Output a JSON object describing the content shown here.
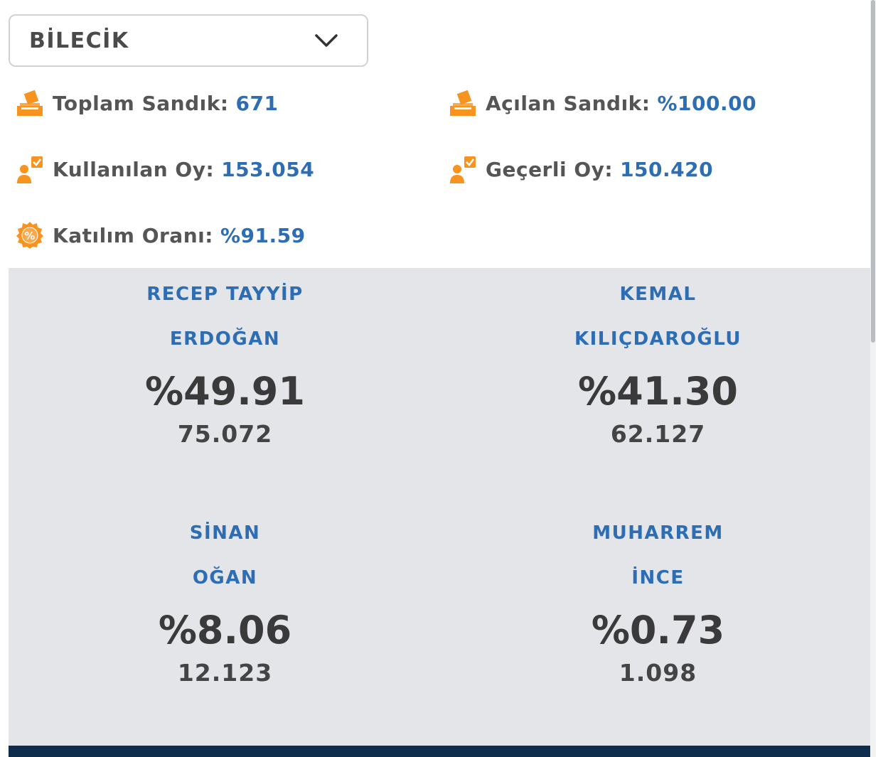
{
  "dropdown": {
    "selected": "BİLECİK"
  },
  "stats": {
    "toplam_sandik": {
      "label": "Toplam Sandık:",
      "value": "671"
    },
    "acilan_sandik": {
      "label": "Açılan Sandık:",
      "value": "%100.00"
    },
    "kullanilan_oy": {
      "label": "Kullanılan Oy:",
      "value": "153.054"
    },
    "gecerli_oy": {
      "label": "Geçerli Oy:",
      "value": "150.420"
    },
    "katilim_orani": {
      "label": "Katılım Oranı:",
      "value": "%91.59"
    }
  },
  "candidates": [
    {
      "first": "RECEP TAYYİP",
      "last": "ERDOĞAN",
      "percent": "%49.91",
      "votes": "75.072"
    },
    {
      "first": "KEMAL",
      "last": "KILIÇDAROĞLU",
      "percent": "%41.30",
      "votes": "62.127"
    },
    {
      "first": "SİNAN",
      "last": "OĞAN",
      "percent": "%8.06",
      "votes": "12.123"
    },
    {
      "first": "MUHARREM",
      "last": "İNCE",
      "percent": "%0.73",
      "votes": "1.098"
    }
  ],
  "colors": {
    "accent": "#2d6db4",
    "icon": "#f7931e",
    "panel": "#e3e5e8",
    "footer": "#0e2d4c"
  },
  "icons": [
    "ballot-box-icon",
    "ballot-box-icon",
    "voter-check-icon",
    "voter-check-icon",
    "percent-badge-icon",
    "chevron-down-icon"
  ]
}
